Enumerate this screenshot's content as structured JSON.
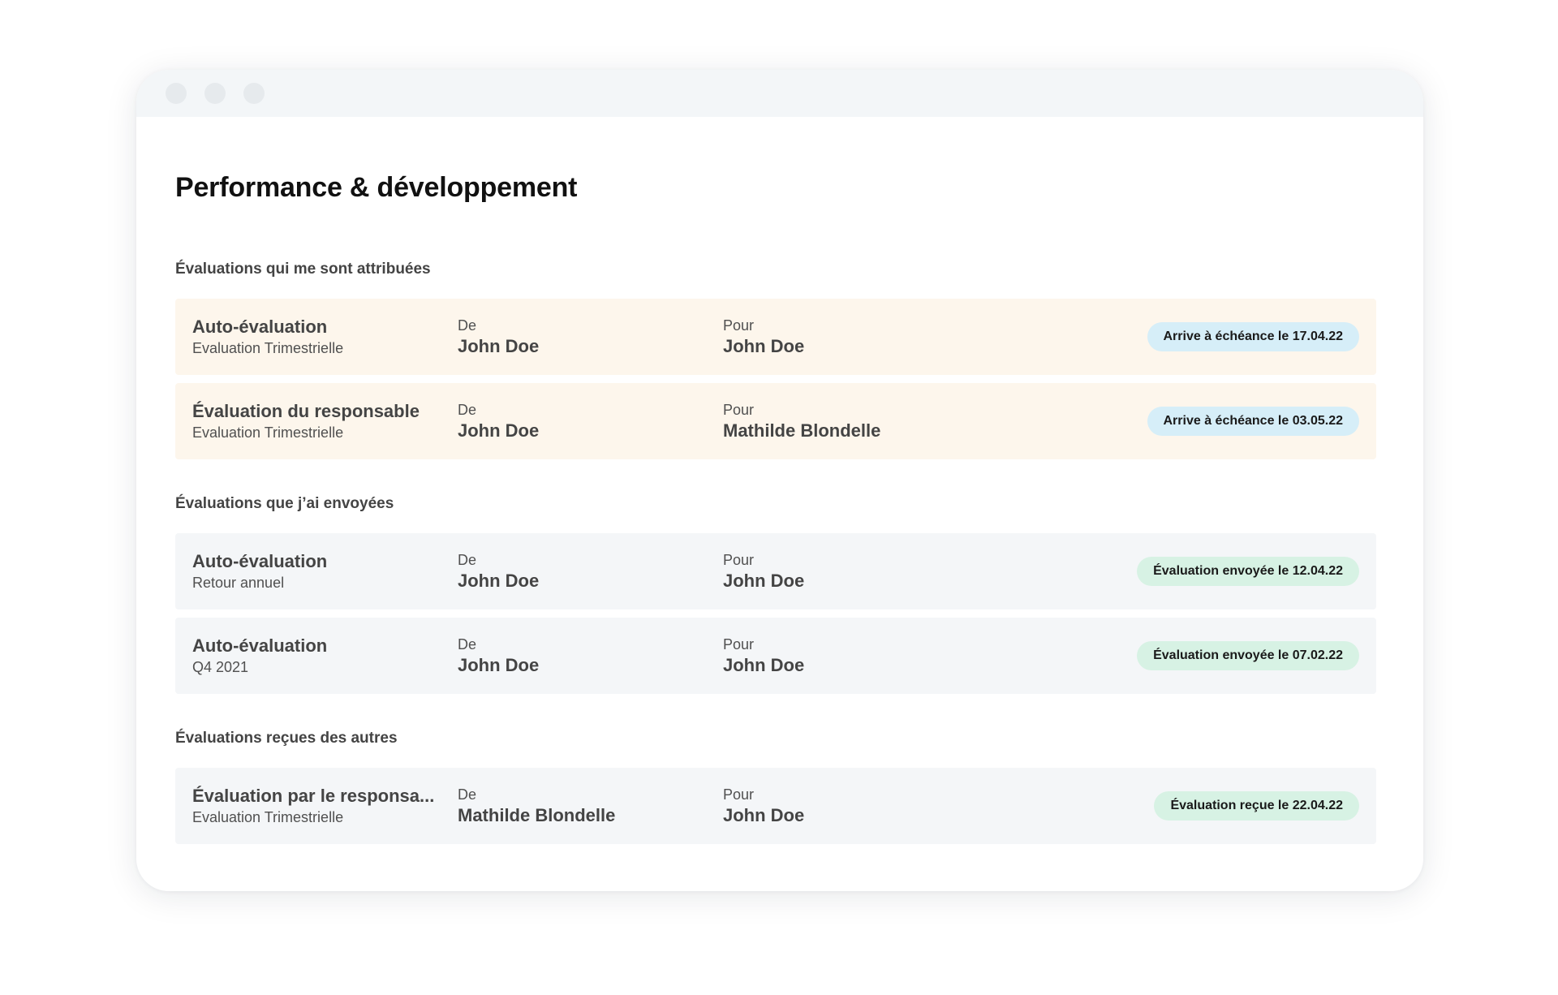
{
  "page_title": "Performance & développement",
  "sections": [
    {
      "title": "Évaluations qui me sont attribuées",
      "rows": [
        {
          "title": "Auto-évaluation",
          "subtitle": "Evaluation Trimestrielle",
          "from_label": "De",
          "from": "John Doe",
          "for_label": "Pour",
          "for": "John Doe",
          "status": "Arrive à échéance le 17.04.22"
        },
        {
          "title": "Évaluation du responsable",
          "subtitle": "Evaluation Trimestrielle",
          "from_label": "De",
          "from": "John Doe",
          "for_label": "Pour",
          "for": "Mathilde Blondelle",
          "status": "Arrive à échéance le 03.05.22"
        }
      ]
    },
    {
      "title": "Évaluations que j’ai envoyées",
      "rows": [
        {
          "title": "Auto-évaluation",
          "subtitle": "Retour annuel",
          "from_label": "De",
          "from": "John Doe",
          "for_label": "Pour",
          "for": "John Doe",
          "status": "Évaluation envoyée le 12.04.22"
        },
        {
          "title": "Auto-évaluation",
          "subtitle": "Q4 2021",
          "from_label": "De",
          "from": "John Doe",
          "for_label": "Pour",
          "for": "John Doe",
          "status": "Évaluation envoyée le 07.02.22"
        }
      ]
    },
    {
      "title": "Évaluations reçues des autres",
      "rows": [
        {
          "title": "Évaluation par le responsa...",
          "subtitle": "Evaluation Trimestrielle",
          "from_label": "De",
          "from": "Mathilde Blondelle",
          "for_label": "Pour",
          "for": "John Doe",
          "status": "Évaluation reçue le 22.04.22"
        }
      ]
    }
  ],
  "colors": {
    "assigned_row_bg": "#fdf6ec",
    "neutral_row_bg": "#f4f6f8",
    "due_badge_bg": "#d6eef8",
    "sent_badge_bg": "#d7f2e4"
  },
  "icons": {
    "window_controls": [
      "window-dot-icon",
      "window-dot-icon",
      "window-dot-icon"
    ]
  }
}
